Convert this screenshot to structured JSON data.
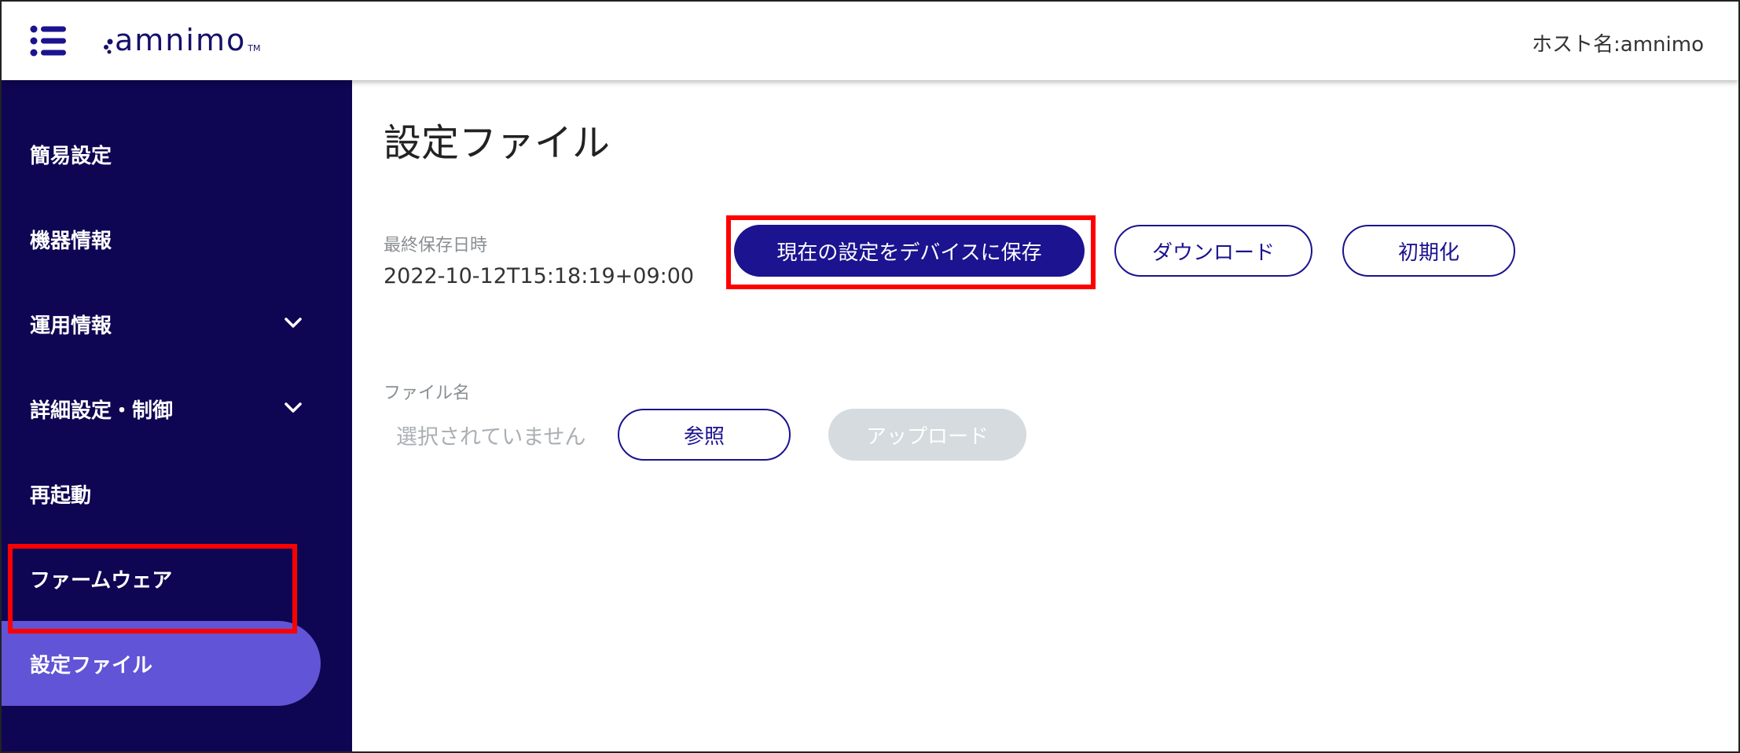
{
  "header": {
    "logo_text": "amnimo",
    "logo_tm": "TM",
    "hostname": "ホスト名:amnimo"
  },
  "sidebar": {
    "items": [
      {
        "label": "簡易設定"
      },
      {
        "label": "機器情報"
      },
      {
        "label": "運用情報",
        "expandable": true
      },
      {
        "label": "詳細設定・制御",
        "expandable": true
      },
      {
        "label": "再起動"
      },
      {
        "label": "ファームウェア"
      },
      {
        "label": "設定ファイル",
        "active": true
      }
    ]
  },
  "main": {
    "title": "設定ファイル",
    "last_saved_label": "最終保存日時",
    "last_saved_value": "2022-10-12T15:18:19+09:00",
    "save_button": "現在の設定をデバイスに保存",
    "download_button": "ダウンロード",
    "reset_button": "初期化",
    "file_name_label": "ファイル名",
    "file_status": "選択されていません",
    "browse_button": "参照",
    "upload_button": "アップロード"
  },
  "colors": {
    "sidebar_bg": "#0e0653",
    "sidebar_active": "#6154d6",
    "primary": "#1b138f",
    "highlight": "#ff0000",
    "disabled": "#d5dbde"
  },
  "icons": {
    "menu": "list-menu-icon",
    "chevron": "chevron-down-icon"
  }
}
